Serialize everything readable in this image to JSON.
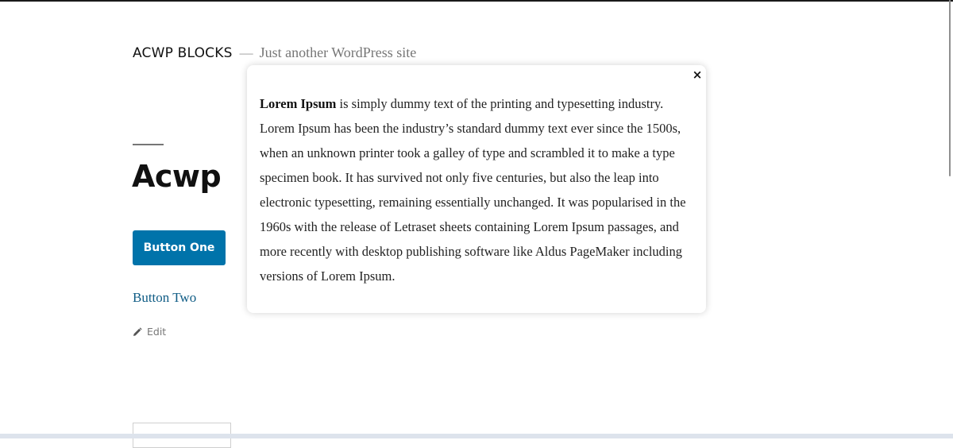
{
  "site": {
    "title": "ACWP BLOCKS",
    "separator": "—",
    "tagline": "Just another WordPress site"
  },
  "entry": {
    "title": "Acwp",
    "button_one": "Button One",
    "button_two": "Button Two",
    "edit_label": "Edit"
  },
  "popup": {
    "close_label": "×",
    "body_bold": "Lorem Ipsum",
    "body_text": " is simply dummy text of the printing and typesetting industry. Lorem Ipsum has been the industry’s standard dummy text ever since the 1500s, when an unknown printer took a galley of type and scrambled it to make a type specimen book. It has survived not only five centuries, but also the leap into electronic typesetting, remaining essentially unchanged. It was popularised in the 1960s with the release of Letraset sheets containing Lorem Ipsum passages, and more recently with desktop publishing software like Aldus PageMaker including versions of Lorem Ipsum."
  },
  "icons": {
    "edit": "pencil-icon",
    "close": "close-icon"
  },
  "colors": {
    "primary_button": "#0073aa",
    "link": "#0f5c85",
    "muted": "#767676"
  }
}
